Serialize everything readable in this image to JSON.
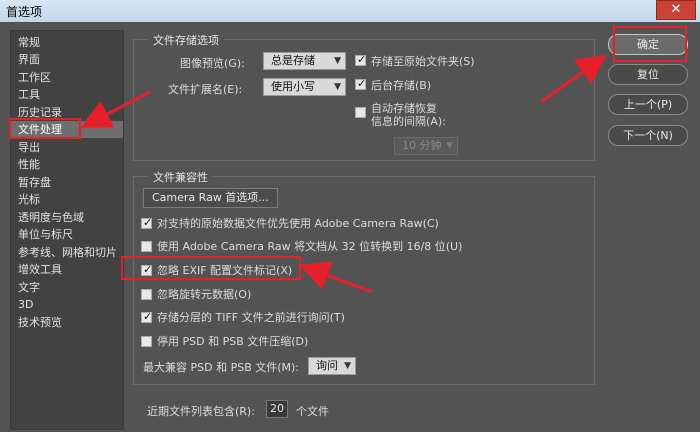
{
  "window": {
    "title": "首选项",
    "close_symbol": "✕"
  },
  "sidebar": {
    "items": [
      {
        "label": "常规"
      },
      {
        "label": "界面"
      },
      {
        "label": "工作区"
      },
      {
        "label": "工具"
      },
      {
        "label": "历史记录"
      },
      {
        "label": "文件处理",
        "active": true
      },
      {
        "label": "导出"
      },
      {
        "label": "性能"
      },
      {
        "label": "暂存盘"
      },
      {
        "label": "光标"
      },
      {
        "label": "透明度与色域"
      },
      {
        "label": "单位与标尺"
      },
      {
        "label": "参考线、网格和切片"
      },
      {
        "label": "增效工具"
      },
      {
        "label": "文字"
      },
      {
        "label": "3D"
      },
      {
        "label": "技术预览"
      }
    ]
  },
  "file_saving": {
    "title": "文件存储选项",
    "image_preview_label": "图像预览(G):",
    "image_preview_value": "总是存储",
    "ext_label": "文件扩展名(E):",
    "ext_value": "使用小写",
    "save_to_original": "存储至原始文件夹(S)",
    "background_save": "后台存储(B)",
    "auto_recover_line1": "自动存储恢复",
    "auto_recover_line2": "信息的间隔(A):",
    "interval_value": "10 分钟"
  },
  "compat": {
    "title": "文件兼容性",
    "camera_raw_button": "Camera Raw 首选项...",
    "opt1": "对支持的原始数据文件优先使用 Adobe Camera Raw(C)",
    "opt2": "使用 Adobe Camera Raw 将文档从 32 位转换到 16/8 位(U)",
    "opt3": "忽略 EXIF 配置文件标记(X)",
    "opt4": "忽略旋转元数据(O)",
    "opt5": "存储分层的 TIFF 文件之前进行询问(T)",
    "opt6": "停用 PSD 和 PSB 文件压缩(D)",
    "max_compat_label": "最大兼容 PSD 和 PSB 文件(M):",
    "max_compat_value": "询问"
  },
  "recent": {
    "label": "近期文件列表包含(R):",
    "value": "20",
    "suffix": "个文件"
  },
  "buttons": {
    "ok": "确定",
    "reset": "复位",
    "prev": "上一个(P)",
    "next": "下一个(N)"
  },
  "colors": {
    "annotation_red": "#e5202a",
    "panel_bg": "#535353"
  }
}
